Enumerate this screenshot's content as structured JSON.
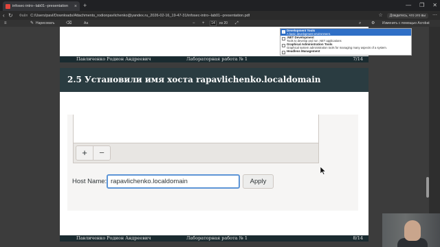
{
  "browser": {
    "tab_title": "infosec-intro--lab01--presentation",
    "tab_close": "×",
    "new_tab": "+",
    "window_controls": [
      "—",
      "❐",
      "✕"
    ],
    "url_prefix": "Файл",
    "url": "C:/Users/pavl/Downloads/Attachments_rodionpavlichenko@yandex.ru_2026-02-16_19-47-31/infosec-intro--lab01--presentation.pdf",
    "yandex_button": "Дождитесь, что это вы"
  },
  "pdf_toolbar": {
    "draw_label": "Нарисовать",
    "text_tool": "Aa",
    "zoom_out": "−",
    "zoom_in": "+",
    "page_current": "14",
    "page_total": "из 20",
    "edit_acrobat": "Изменить с помощью Acrobat"
  },
  "page7": {
    "software_list": [
      {
        "title": "Development Tools",
        "desc": "A basic development environment.",
        "checked": true,
        "selected": true
      },
      {
        "title": ".NET Development",
        "desc": "Tools to develop and run .NET applications",
        "checked": false,
        "selected": false
      },
      {
        "title": "Graphical Administration Tools",
        "desc": "Graphical system administration tools for managing many aspects of a system.",
        "checked": false,
        "selected": false
      },
      {
        "title": "Headless Management",
        "desc": "",
        "checked": false,
        "selected": false
      }
    ],
    "footer": {
      "author": "Павличенко Родион Андреевич",
      "work": "Лабораторная работа № 1",
      "page": "7/14"
    }
  },
  "page8": {
    "title": "2.5 Установили имя хоста rapavlichenko.localdomain",
    "add_button": "+",
    "remove_button": "−",
    "host_label": "Host Name:",
    "host_value": "rapavlichenko.localdomain",
    "apply_button": "Apply",
    "footer": {
      "author": "Павличенко Родион Андреевич",
      "work": "Лабораторная работа № 1",
      "page": "8/14"
    }
  },
  "colors": {
    "slide_header": "#2a3c41",
    "footer_bg": "#1a2b30",
    "focus_border": "#5c94d6",
    "selection": "#2f6fc6"
  }
}
